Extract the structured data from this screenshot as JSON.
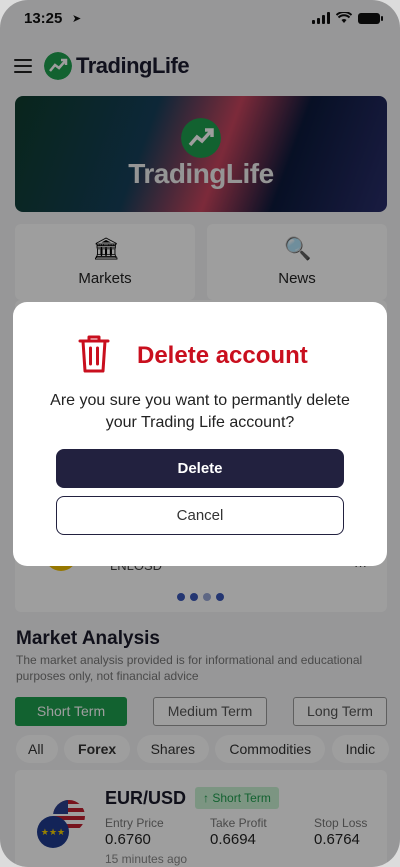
{
  "status_bar": {
    "time": "13:25"
  },
  "app": {
    "logo_text": "TradingLife"
  },
  "banner": {
    "text": "TradingLife"
  },
  "tiles": [
    {
      "label": "Markets",
      "icon": "bank-icon"
    },
    {
      "label": "News",
      "icon": "news-search-icon"
    }
  ],
  "behind": {
    "pair": "LNLOSD",
    "value": "···"
  },
  "carousel": {
    "dots": 4,
    "active": 2
  },
  "market_analysis": {
    "title": "Market Analysis",
    "description": "The market analysis provided is for informational and educational purposes only, not financial advice",
    "terms": [
      {
        "label": "Short Term",
        "active": true
      },
      {
        "label": "Medium Term",
        "active": false
      },
      {
        "label": "Long Term",
        "active": false
      }
    ],
    "categories": [
      {
        "label": "All"
      },
      {
        "label": "Forex",
        "active": true
      },
      {
        "label": "Shares"
      },
      {
        "label": "Commodities"
      },
      {
        "label": "Indic"
      }
    ]
  },
  "signal": {
    "pair": "EUR/USD",
    "badge": "Short Term",
    "columns": [
      {
        "label": "Entry Price",
        "value": "0.6760"
      },
      {
        "label": "Take Profit",
        "value": "0.6694"
      },
      {
        "label": "Stop Loss",
        "value": "0.6764"
      }
    ],
    "time_ago": "15 minutes ago"
  },
  "modal": {
    "title": "Delete account",
    "message": "Are you sure you want to permantly delete your Trading Life account?",
    "delete_label": "Delete",
    "cancel_label": "Cancel"
  },
  "colors": {
    "brand_green": "#1e9e4e",
    "danger_red": "#c90f1e",
    "dark_button": "#22213f"
  }
}
